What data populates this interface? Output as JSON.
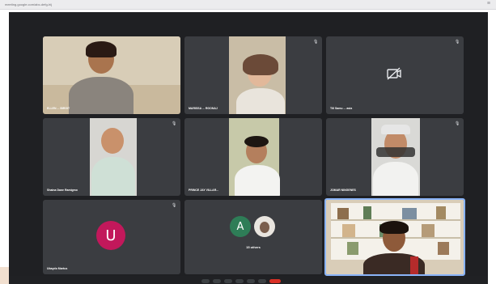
{
  "window": {
    "title": "meeting.google.com/abc-defg-hij",
    "menu_icon": "kebab-menu-icon"
  },
  "participants": [
    {
      "name": "ELLEN ... BIRGIT",
      "muted": false
    },
    {
      "name": "MARISSA ... RGONAJ",
      "muted": true
    },
    {
      "name": "Till Samu ... asia",
      "muted": true,
      "camera_off": true
    },
    {
      "name": "Shaina Dane Ramigmo",
      "muted": true
    },
    {
      "name": "PRINCE JAY VILLAR...",
      "muted": false
    },
    {
      "name": "JOMAR NINGENES",
      "muted": true
    },
    {
      "name": "Ubaydo Martus",
      "muted": true,
      "avatar_letter": "U",
      "avatar_color": "#c2185b"
    },
    {
      "name": "",
      "others_label": "15 others",
      "avatar_letter": "A",
      "avatar_color": "#2e7d57"
    },
    {
      "name": "",
      "muted": false,
      "presenter": true
    }
  ],
  "controls": {
    "end_call_color": "#d93025"
  }
}
